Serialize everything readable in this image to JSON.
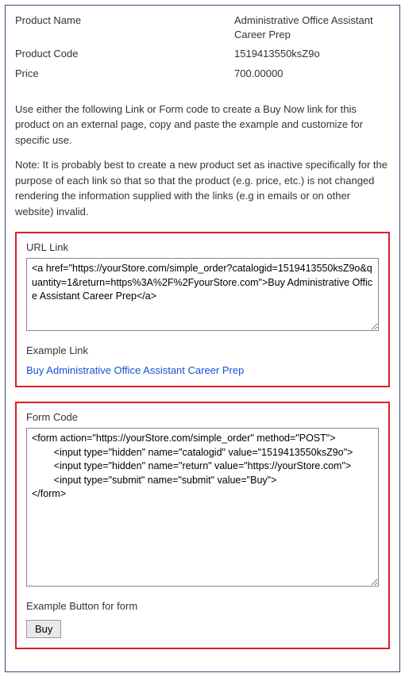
{
  "header": {
    "product_name_label": "Product Name",
    "product_name_value": "Administrative Office Assistant Career Prep",
    "product_code_label": "Product Code",
    "product_code_value": "1519413550ksZ9o",
    "price_label": "Price",
    "price_value": "700.00000"
  },
  "instructions": "Use either the following Link or Form code to create a Buy Now link for this product on an external page, copy and paste the example and customize for specific use.",
  "note": "Note: It is probably best to create a new product set as inactive specifically for the purpose of each link so that so that the product (e.g. price, etc.) is not changed rendering the information supplied with the links (e.g in emails or on other website) invalid.",
  "url_box": {
    "title": "URL Link",
    "code": "<a href=\"https://yourStore.com/simple_order?catalogid=1519413550ksZ9o&quantity=1&return=https%3A%2F%2FyourStore.com\">Buy Administrative Office Assistant Career Prep</a>",
    "example_label": "Example Link",
    "example_link_text": "Buy Administrative Office Assistant Career Prep"
  },
  "form_box": {
    "title": "Form Code",
    "code": "<form action=\"https://yourStore.com/simple_order\" method=\"POST\">\n        <input type=\"hidden\" name=\"catalogid\" value=\"1519413550ksZ9o\">\n        <input type=\"hidden\" name=\"return\" value=\"https://yourStore.com\">\n        <input type=\"submit\" name=\"submit\" value=\"Buy\">\n</form>",
    "example_label": "Example Button for form",
    "button_label": "Buy"
  }
}
